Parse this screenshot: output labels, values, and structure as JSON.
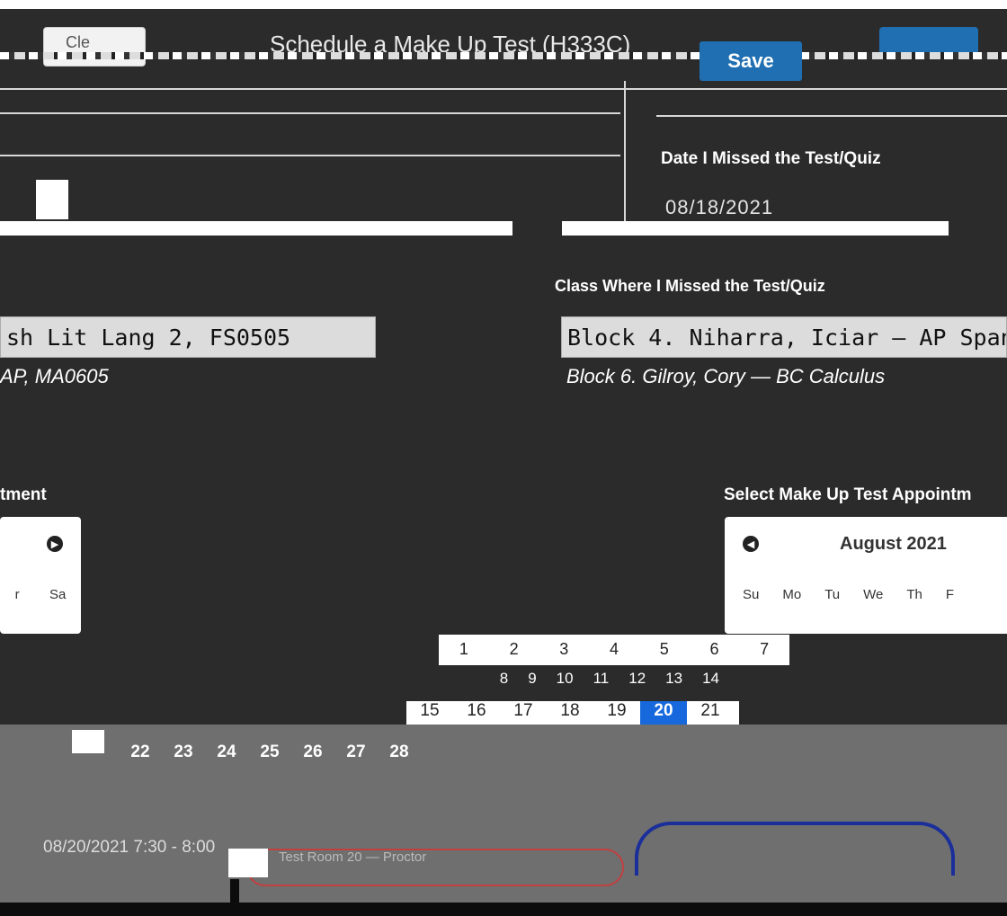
{
  "header": {
    "clear_label": "Cle",
    "title": "Schedule a Make Up Test (H333C)",
    "save_label": "Save"
  },
  "date_missed": {
    "label": "Date I Missed the Test/Quiz",
    "value": "08/18/2021"
  },
  "class_missed": {
    "label": "Class Where I Missed the Test/Quiz",
    "left_selected": "sh Lit Lang 2, FS0505",
    "left_option": "AP, MA0605",
    "right_selected": "Block 4. Niharra, Iciar — AP Span",
    "right_option": "Block 6. Gilroy, Cory — BC Calculus"
  },
  "appointment": {
    "left_label": "tment",
    "right_label": "Select Make Up Test Appointm",
    "left_calendar": {
      "dow": [
        "r",
        "Sa"
      ]
    },
    "right_calendar": {
      "month": "August 2021",
      "dow": [
        "Su",
        "Mo",
        "Tu",
        "We",
        "Th",
        "F"
      ]
    },
    "week1": [
      "1",
      "2",
      "3",
      "4",
      "5",
      "6",
      "7"
    ],
    "week2": [
      "8",
      "9",
      "10",
      "11",
      "12",
      "13",
      "14"
    ],
    "week3": [
      "15",
      "16",
      "17",
      "18",
      "19",
      "20",
      "21"
    ],
    "week4": [
      "22",
      "23",
      "24",
      "25",
      "26",
      "27",
      "28"
    ],
    "selected_day": "20"
  },
  "slot": {
    "text": "08/20/2021 7:30 - 8:00",
    "sub": "Test Room 20 — Proctor"
  },
  "colors": {
    "accent": "#1f6fb2",
    "selected": "#1668dc"
  }
}
